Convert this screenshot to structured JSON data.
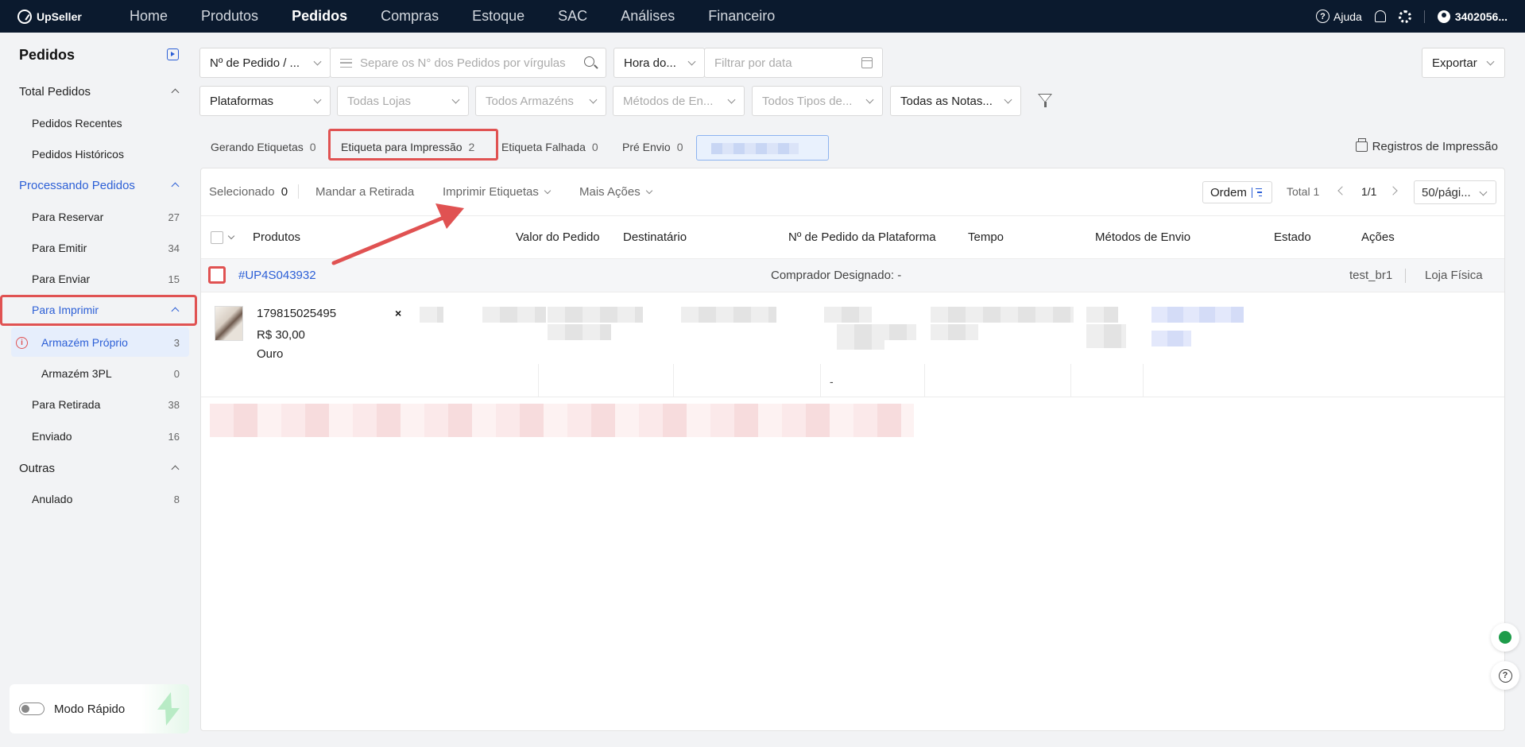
{
  "app": {
    "brand": "UpSeller"
  },
  "topnav": {
    "items": [
      "Home",
      "Produtos",
      "Pedidos",
      "Compras",
      "Estoque",
      "SAC",
      "Análises",
      "Financeiro"
    ],
    "active": "Pedidos",
    "help_label": "Ajuda",
    "user_label": "3402056..."
  },
  "sidebar": {
    "title": "Pedidos",
    "groups": {
      "total": {
        "label": "Total Pedidos"
      },
      "processing": {
        "label": "Processando Pedidos"
      },
      "outras": {
        "label": "Outras"
      }
    },
    "items": {
      "recentes": {
        "label": "Pedidos Recentes"
      },
      "historicos": {
        "label": "Pedidos Históricos"
      },
      "reservar": {
        "label": "Para Reservar",
        "count": "27"
      },
      "emitir": {
        "label": "Para Emitir",
        "count": "34"
      },
      "enviar": {
        "label": "Para Enviar",
        "count": "15"
      },
      "imprimir": {
        "label": "Para Imprimir"
      },
      "proprio": {
        "label": "Armazém Próprio",
        "count": "3"
      },
      "tpl": {
        "label": "Armazém 3PL",
        "count": "0"
      },
      "retirada": {
        "label": "Para Retirada",
        "count": "38"
      },
      "enviado": {
        "label": "Enviado",
        "count": "16"
      },
      "anulado": {
        "label": "Anulado",
        "count": "8"
      }
    },
    "quick_mode_label": "Modo Rápido"
  },
  "filters": {
    "order_type": "Nº de Pedido / ...",
    "search_placeholder": "Separe os N° dos Pedidos por vírgulas",
    "time_type": "Hora do...",
    "date_placeholder": "Filtrar por data",
    "export_label": "Exportar",
    "platforms": "Plataformas",
    "stores_placeholder": "Todas Lojas",
    "warehouses_placeholder": "Todos Armazéns",
    "shipping_placeholder": "Métodos de En...",
    "types_placeholder": "Todos Tipos de...",
    "notes": "Todas as Notas..."
  },
  "tabs": [
    {
      "label": "Gerando Etiquetas",
      "count": "0"
    },
    {
      "label": "Etiqueta para Impressão",
      "count": "2"
    },
    {
      "label": "Etiqueta Falhada",
      "count": "0"
    },
    {
      "label": "Pré Envio",
      "count": "0"
    }
  ],
  "print_log_label": "Registros de Impressão",
  "toolbar": {
    "selected_label": "Selecionado",
    "selected_count": "0",
    "pickup_label": "Mandar a Retirada",
    "print_labels": "Imprimir Etiquetas",
    "more_actions": "Mais Ações",
    "order_label": "Ordem",
    "total_label": "Total 1",
    "page": "1/1",
    "per_page": "50/pági..."
  },
  "table": {
    "columns": [
      "Produtos",
      "Valor do Pedido",
      "Destinatário",
      "Nº de Pedido da Plataforma",
      "Tempo",
      "Métodos de Envio",
      "Estado",
      "Ações"
    ]
  },
  "order": {
    "id": "#UP4S043932",
    "buyer": "Comprador Designado: -",
    "store": "test_br1",
    "store_type": "Loja Física",
    "sku": "179815025495",
    "price": "R$ 30,00",
    "variant": "Ouro",
    "close_glyph": "×",
    "tempo_dash": "-"
  },
  "colors": {
    "accent": "#2c5fd6",
    "nav_bg": "#0b1a2e",
    "highlight": "#e05252"
  }
}
